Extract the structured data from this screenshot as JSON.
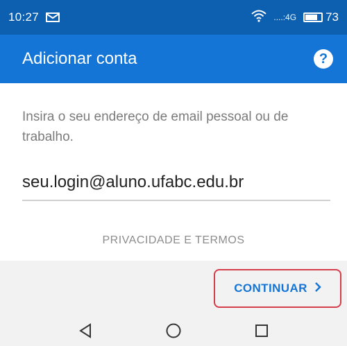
{
  "status_bar": {
    "time": "10:27",
    "signal_text": "....:4G",
    "battery": "73",
    "battery_level_percent": 73
  },
  "app_bar": {
    "title": "Adicionar conta",
    "help_symbol": "?"
  },
  "form": {
    "instruction": "Insira o seu endereço de email pessoal ou de trabalho.",
    "email_value": "seu.login@aluno.ufabc.edu.br",
    "privacy_link": "PRIVACIDADE E TERMOS",
    "continue_label": "CONTINUAR",
    "continue_arrow": "›"
  },
  "icons": {
    "mail": "mail-icon",
    "wifi": "wifi-icon",
    "back": "back-triangle-icon",
    "home": "home-circle-icon",
    "recents": "recents-square-icon"
  },
  "colors": {
    "status_bar": "#0d5fb0",
    "app_bar": "#1575d6",
    "accent": "#1575d6",
    "highlight_border": "#d43d4a"
  }
}
